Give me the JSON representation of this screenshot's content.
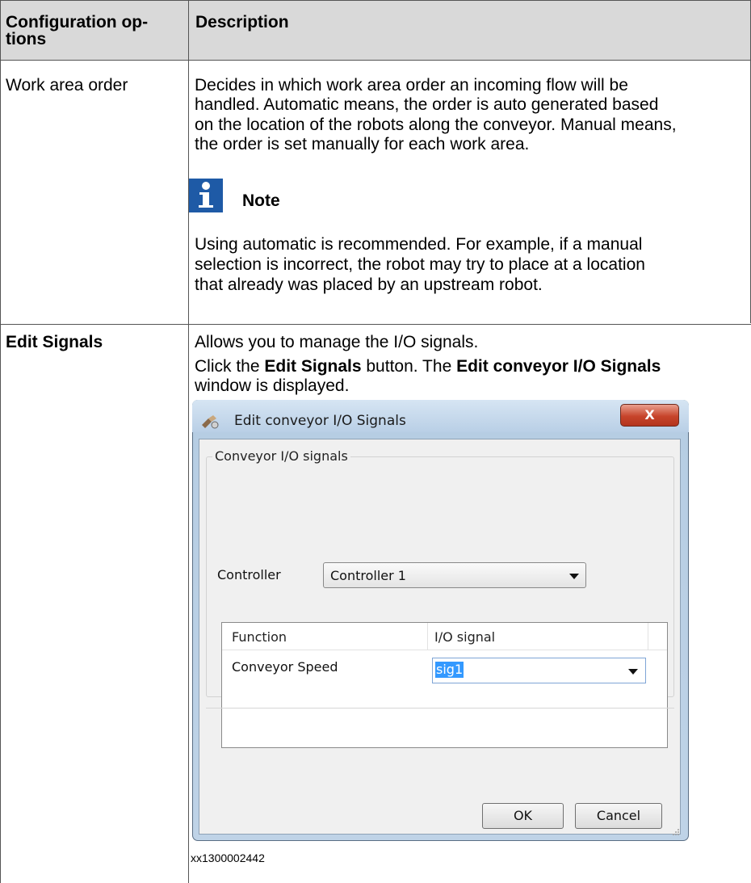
{
  "table": {
    "header": {
      "col1_line1": "Configuration op-",
      "col1_line2": "tions",
      "col2": "Description"
    },
    "rows": [
      {
        "option": "Work area order",
        "description_lines": [
          "Decides in which work area order an incoming flow will be",
          "handled. Automatic means, the order is auto generated based",
          "on the location of the robots along the conveyor. Manual means,",
          "the order is set manually for each work area."
        ],
        "note_label": "Note",
        "note_icon": "info-icon",
        "note_lines": [
          "Using automatic is recommended. For example, if a manual",
          "selection is incorrect, the robot may try to place at a location",
          "that already was placed by an upstream robot."
        ]
      },
      {
        "option": "Edit Signals",
        "line1": "Allows you to manage the I/O signals.",
        "line2_pre": "Click the ",
        "line2_b1": "Edit Signals",
        "line2_mid": " button. The ",
        "line2_b2": "Edit conveyor I/O Signals",
        "line3": "window is displayed.",
        "figure_caption": "xx1300002442"
      }
    ]
  },
  "dialog": {
    "title": "Edit conveyor I/O Signals",
    "close_label": "X",
    "group_label": "Conveyor I/O signals",
    "controller_label": "Controller",
    "controller_value": "Controller 1",
    "grid_headers": [
      "Function",
      "I/O signal"
    ],
    "grid_rows": [
      {
        "function": "Conveyor Speed",
        "signal": "sig1"
      }
    ],
    "ok_label": "OK",
    "cancel_label": "Cancel"
  },
  "colors": {
    "header_bg": "#d9d9d9",
    "note_icon_bg": "#1e5aa6",
    "selection_bg": "#3399ff",
    "close_button": "#c7442b"
  }
}
